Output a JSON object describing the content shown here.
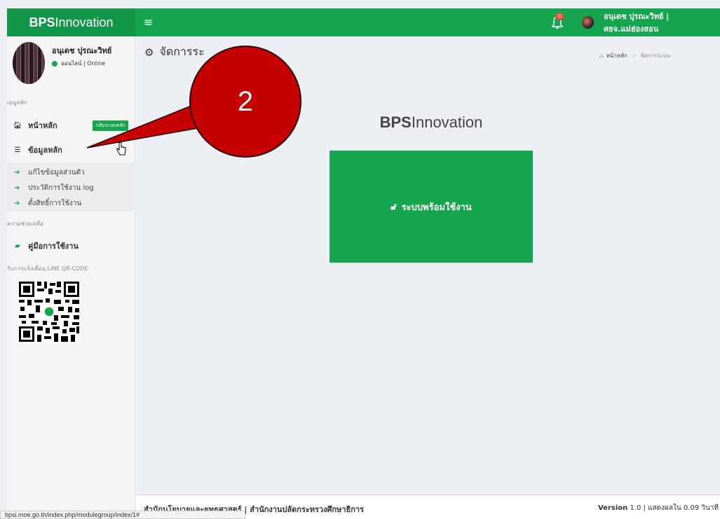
{
  "header": {
    "logo_bold": "BPS",
    "logo_rest": "Innovation",
    "menu_glyph": "≡",
    "notification_count": "11",
    "user_label": "อนุเดช ปุรณะวิทย์ | ศธจ.แม่ฮ่องสอน",
    "color": "#16a54f"
  },
  "sidebar": {
    "user_name": "อนุเดช ปุรณะวิทย์",
    "status": "ออนไลน์ | Online",
    "section_main": "เมนูหลัก",
    "home_label": "หน้าหลัก",
    "home_badge": "กลับระบบหลัก",
    "master_label": "ข้อมูลหลัก",
    "submenu": [
      "แก้ไขข้อมูลส่วนตัว",
      "ประวัติการใช้งาน log",
      "ตั้งสิทธิ์การใช้งาน"
    ],
    "section_help": "ความช่วยเหลือ",
    "manual_label": "คู่มือการใช้งาน",
    "section_line": "รับการแจ้งเตือน LINE QR-CODE"
  },
  "content": {
    "title": "จัดการระ",
    "breadcrumb_home": "หน้าหลัก",
    "breadcrumb_current": "จัดการระบบ",
    "brand_bold": "BPS",
    "brand_rest": "Innovation",
    "ready_label": "ระบบพร้อมใช้งาน"
  },
  "annotation": {
    "number": "2",
    "color": "#c50000"
  },
  "footer": {
    "left": "สำนักนโยบายและยุทธศาสตร์ | สำนักงานปลัดกระทรวงศึกษาธิการ",
    "version_label": "Version",
    "version_rest": " 1.0 | แสดงผลใน 0.09 วินาที"
  },
  "statusbar": {
    "url": "bpsi.moe.go.th/index.php/modulegroup/index/1#"
  },
  "icons": {
    "bell": "bell-icon",
    "home": "home-icon",
    "list": "list-icon",
    "sign_in": "sign-in-icon",
    "book": "book-icon",
    "gears": "gears-icon",
    "sitemap": "sitemap-icon",
    "unlock": "unlock-icon"
  }
}
